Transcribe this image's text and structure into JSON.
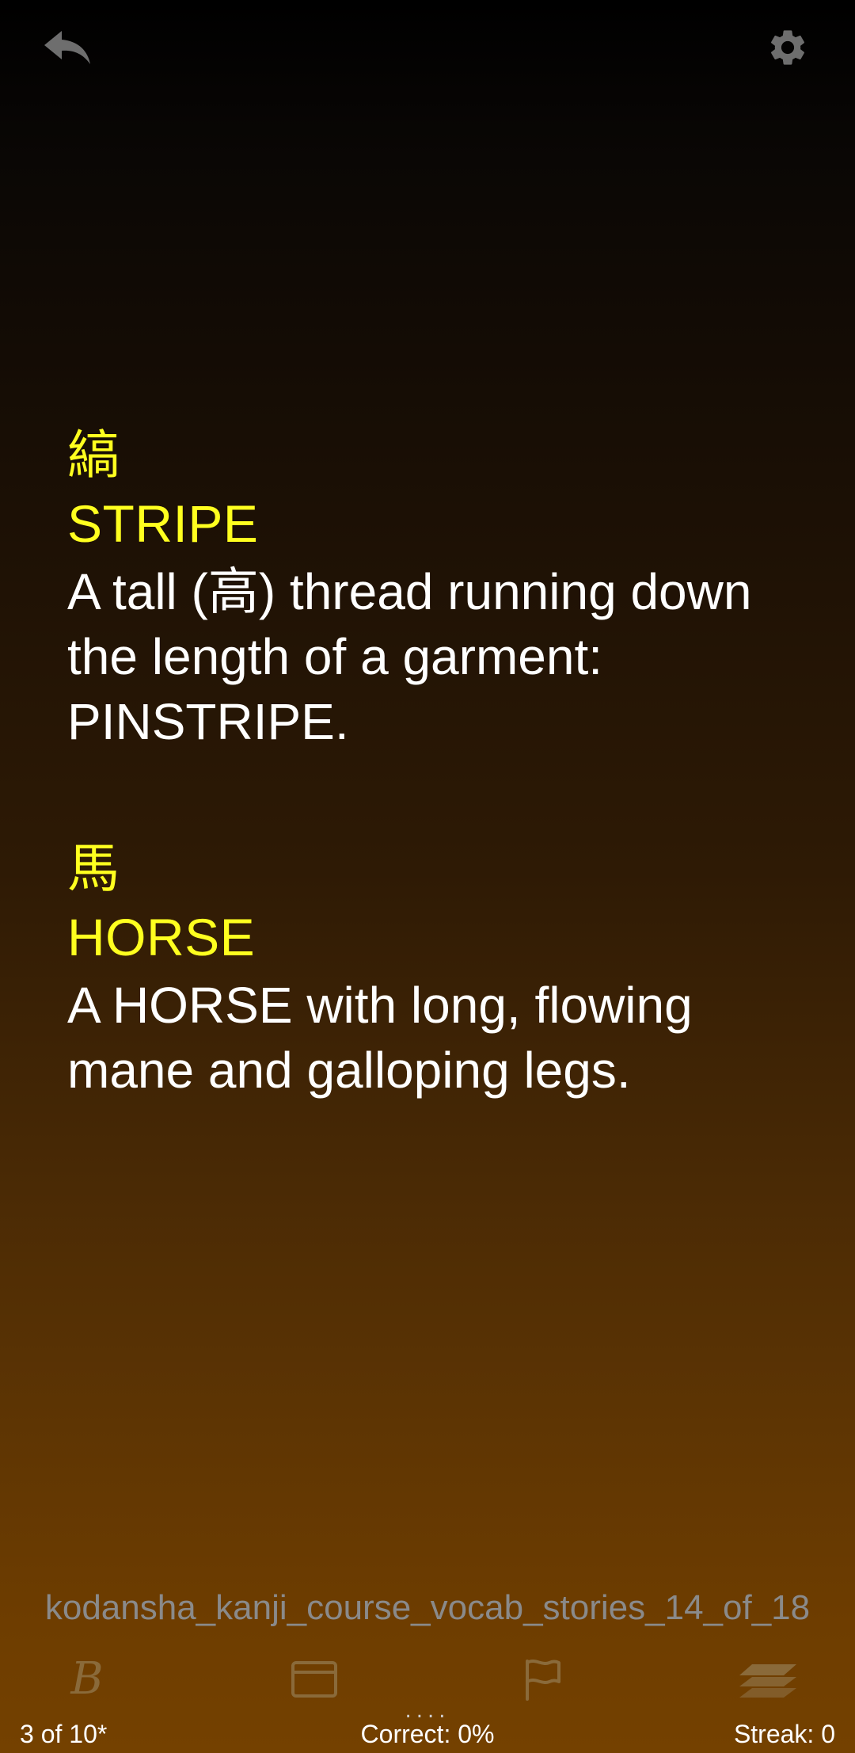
{
  "toolbar_top": {
    "back_icon": "back-arrow-icon",
    "settings_icon": "gear-icon"
  },
  "entries": [
    {
      "kanji": "縞",
      "keyword": "STRIPE",
      "story": "A tall (高) thread running down the length of a garment: PINSTRIPE."
    },
    {
      "kanji": "馬",
      "keyword": "HORSE",
      "story": "A HORSE with long, flowing mane and galloping legs."
    }
  ],
  "deck_name": "kodansha_kanji_course_vocab_stories_14_of_18",
  "bottom_toolbar": {
    "items": [
      {
        "icon": "bold-b-icon",
        "glyph": "B"
      },
      {
        "icon": "card-icon"
      },
      {
        "icon": "flag-icon"
      },
      {
        "icon": "stack-icon"
      }
    ]
  },
  "progress_dots": "....",
  "status": {
    "position": "3 of 10*",
    "correct": "Correct: 0%",
    "streak": "Streak: 0"
  },
  "colors": {
    "keyword": "#ffff1f",
    "story": "#ffffff",
    "icon_muted": "#8a6a3a",
    "top_icon": "#6e6e6e",
    "deck_name": "#8a8a8a"
  }
}
